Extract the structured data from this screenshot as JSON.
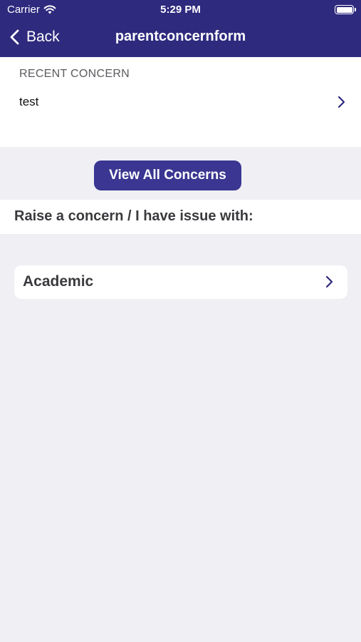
{
  "status_bar": {
    "carrier": "Carrier",
    "time": "5:29 PM"
  },
  "nav": {
    "back_label": "Back",
    "title": "parentconcernform"
  },
  "recent": {
    "header": "RECENT CONCERN",
    "item": "test"
  },
  "view_all_label": "View All Concerns",
  "raise_label": "Raise a concern / I have issue with:",
  "categories": [
    {
      "label": "Academic"
    }
  ],
  "colors": {
    "header_bg": "#2e2a7e",
    "button_bg": "#3a3691",
    "page_bg": "#efeff4"
  }
}
